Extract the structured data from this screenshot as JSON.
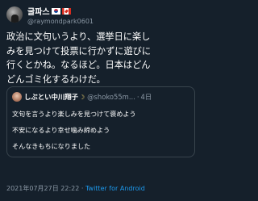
{
  "tweet": {
    "author": {
      "display_name": "굴파스",
      "flags": [
        "kr-flag-icon",
        "ca-flag-icon"
      ],
      "handle": "@raymondpark0601"
    },
    "text": "政治に文句いうより、選挙日に楽し\nみを見つけて投票に行かずに遊びに\n行くとかね。なるほど。日本はどん\nどんゴミ化するわけだ。",
    "quoted": {
      "display_name": "しぶとい中川翔子",
      "badge_icon": "moon-icon",
      "handle": "@shoko55m...",
      "separator": "·",
      "date": "4日",
      "lines": [
        "文句を言うより楽しみを見つけて褒めよう",
        "不安になるより幸せ噛み締めよう",
        "そんなきもちになりました"
      ]
    },
    "timestamp": "2021年07月27日 22:22",
    "separator": "·",
    "source": "Twitter for Android"
  },
  "colors": {
    "background": "#15202b",
    "text": "#ffffff",
    "secondary": "#8b98a5",
    "link": "#1d9bf0",
    "border": "#38444d"
  }
}
